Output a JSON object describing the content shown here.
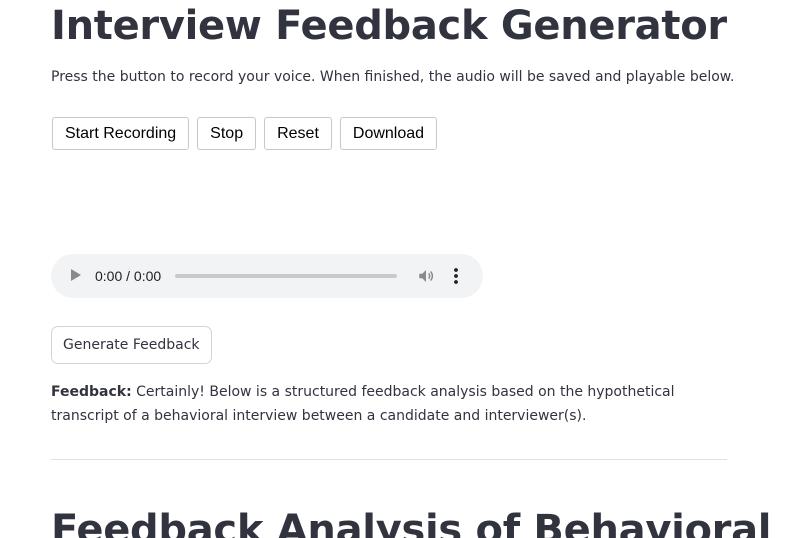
{
  "header": {
    "title": "Interview Feedback Generator"
  },
  "instructions": "Press the button to record your voice. When finished, the audio will be saved and playable below.",
  "recorder": {
    "start_label": "Start Recording",
    "stop_label": "Stop",
    "reset_label": "Reset",
    "download_label": "Download"
  },
  "audio_player": {
    "time": "0:00 / 0:00",
    "progress": 0,
    "icons": {
      "play": "play-icon",
      "volume": "volume-icon",
      "more": "more-options-icon"
    }
  },
  "generate": {
    "label": "Generate Feedback"
  },
  "feedback": {
    "label": "Feedback:",
    "text": " Certainly! Below is a structured feedback analysis based on the hypothetical transcript of a behavioral interview between a candidate and interviewer(s)."
  },
  "section": {
    "heading": "Feedback Analysis of Behavioral"
  },
  "colors": {
    "text": "#31333f",
    "player_background": "#f1f3f4",
    "button_border": "#c8c8cc",
    "divider": "#e0e0e4"
  }
}
